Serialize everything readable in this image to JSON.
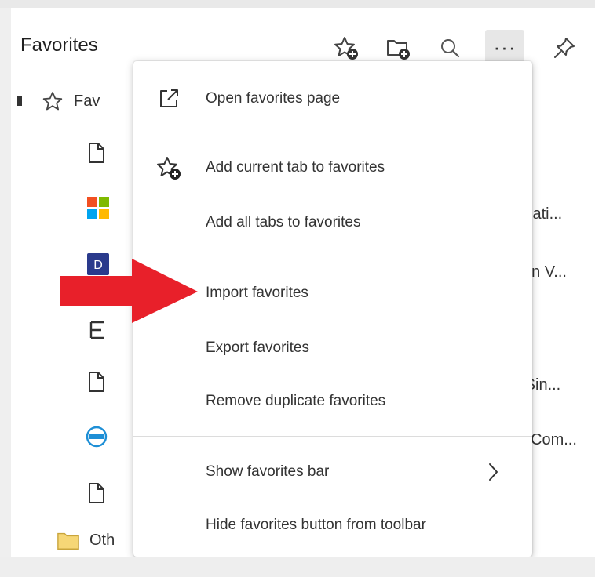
{
  "header": {
    "title": "Favorites",
    "icons": [
      "add-to-favorites-icon",
      "add-folder-icon",
      "search-icon",
      "more-options-icon",
      "pin-icon"
    ],
    "more_label": "···"
  },
  "favorites_list": {
    "root_label": "Fav",
    "other_label": "Oth",
    "truncated_right": [
      "icati...",
      "on V...",
      "-Sin...",
      "Com..."
    ]
  },
  "menu": {
    "items": [
      {
        "label": "Open favorites page"
      },
      {
        "label": "Add current tab to favorites"
      },
      {
        "label": "Add all tabs to favorites"
      },
      {
        "label": "Import favorites"
      },
      {
        "label": "Export favorites"
      },
      {
        "label": "Remove duplicate favorites"
      },
      {
        "label": "Show favorites bar"
      },
      {
        "label": "Hide favorites button from toolbar"
      }
    ]
  },
  "colors": {
    "annotation_arrow": "#e8202a",
    "menu_background": "#ffffff",
    "highlight": "#e7e7e7"
  }
}
